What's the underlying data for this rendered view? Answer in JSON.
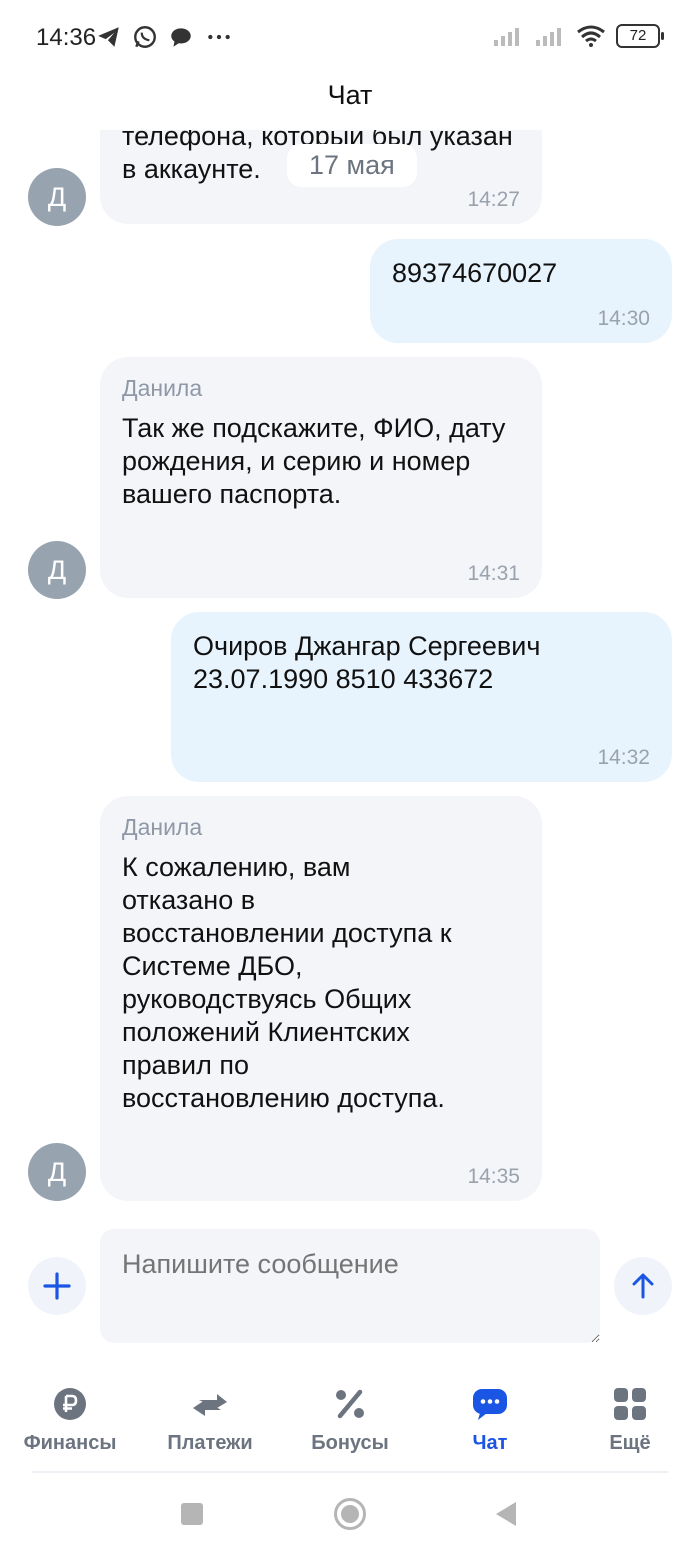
{
  "status_bar": {
    "time": "14:36",
    "battery": "72",
    "left_icons": [
      "telegram-icon",
      "whatsapp-icon",
      "message-icon",
      "more-dots-icon"
    ],
    "right_icons": [
      "signal-icon",
      "signal-icon",
      "wifi-icon",
      "battery-icon"
    ]
  },
  "header": {
    "title": "Чат"
  },
  "chat": {
    "date_chip": "17 мая",
    "messages": [
      {
        "direction": "in",
        "text": "телефона, который был указан в аккаунте.",
        "time": "14:27",
        "avatar": "Д"
      },
      {
        "direction": "out",
        "text": "89374670027",
        "time": "14:30"
      },
      {
        "direction": "in",
        "sender": "Данила",
        "text": "Так же подскажите, ФИО, дату рождения, и серию и номер вашего паспорта.",
        "time": "14:31",
        "avatar": "Д"
      },
      {
        "direction": "out",
        "text": "Очиров Джангар Сергеевич 23.07.1990 8510 433672",
        "time": "14:32"
      },
      {
        "direction": "in",
        "sender": "Данила",
        "text": "К сожалению, вам отказано в восстановлении доступа к Системе ДБО, руководствуясь Общих положений Клиентских правил по восстановлению доступа.",
        "time": "14:35",
        "avatar": "Д"
      }
    ]
  },
  "composer": {
    "placeholder": "Напишите сообщение"
  },
  "bottom_nav": {
    "items": [
      {
        "label": "Финансы",
        "icon": "ruble-icon",
        "active": false
      },
      {
        "label": "Платежи",
        "icon": "transfer-arrows-icon",
        "active": false
      },
      {
        "label": "Бонусы",
        "icon": "percent-icon",
        "active": false
      },
      {
        "label": "Чат",
        "icon": "chat-bubble-icon",
        "active": true
      },
      {
        "label": "Ещё",
        "icon": "grid-icon",
        "active": false
      }
    ]
  },
  "colors": {
    "accent": "#1a55e3",
    "incoming_bubble": "#f3f5f9",
    "outgoing_bubble": "#e8f4fd",
    "avatar": "#98a3b0",
    "muted_text": "#8f98a6"
  }
}
